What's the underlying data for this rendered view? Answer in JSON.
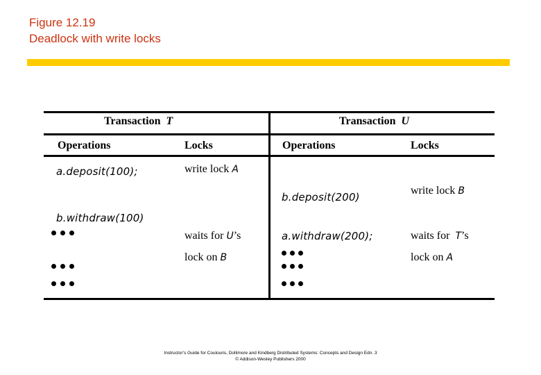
{
  "figure": {
    "number": "Figure 12.19",
    "title": "Deadlock with write locks",
    "accent_color": "#ffcc00",
    "title_color": "#cc3311"
  },
  "table": {
    "transaction_t": {
      "header_prefix": "Transaction",
      "header_name": "T",
      "columns": [
        "Operations",
        "Locks"
      ],
      "rows": [
        {
          "operation": "a.deposit(100);",
          "lock_text": "write lock",
          "lock_var": "A"
        },
        {
          "operation": "b.withdraw(100)",
          "lock_line1_text": "waits for",
          "lock_line1_var": "U",
          "lock_line1_suffix": "’s",
          "lock_line2_text": "lock on",
          "lock_line2_var": "B"
        }
      ],
      "ellipsis": "•••"
    },
    "transaction_u": {
      "header_prefix": "Transaction",
      "header_name": "U",
      "columns": [
        "Operations",
        "Locks"
      ],
      "rows": [
        {
          "operation": "b.deposit(200)",
          "lock_text": "write lock",
          "lock_var": "B"
        },
        {
          "operation": "a.withdraw(200);",
          "lock_line1_text": "waits for",
          "lock_line1_var": "T",
          "lock_line1_suffix": "’s",
          "lock_line2_text": "lock on",
          "lock_line2_var": "A"
        }
      ],
      "ellipsis": "•••"
    }
  },
  "footer": {
    "line1": "Instructor’s Guide for  Coulouris, Dollimore and Kindberg   Distributed Systems: Concepts and Design   Edn. 3",
    "line2": "© Addison-Wesley Publishers 2000"
  }
}
